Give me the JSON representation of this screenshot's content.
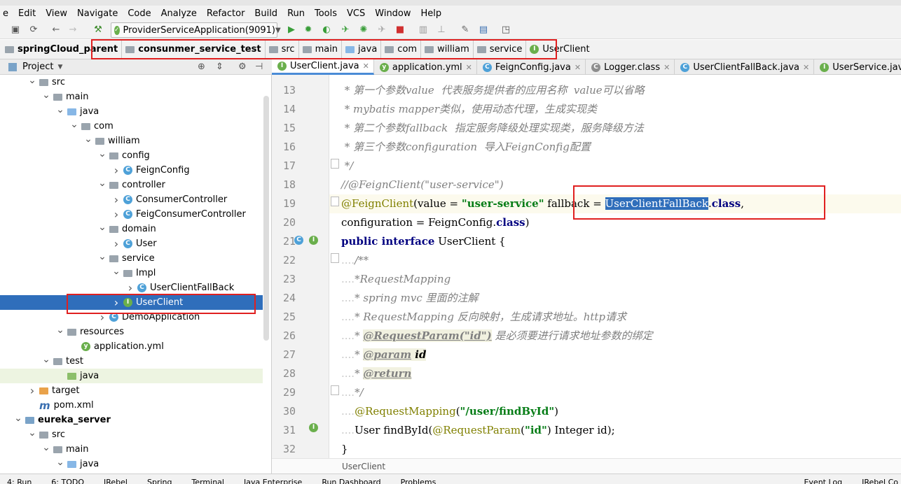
{
  "menu": [
    "e",
    "Edit",
    "View",
    "Navigate",
    "Code",
    "Analyze",
    "Refactor",
    "Build",
    "Run",
    "Tools",
    "VCS",
    "Window",
    "Help"
  ],
  "toolbar": {
    "run_config": "ProviderServiceApplication(9091)"
  },
  "breadcrumb": [
    "springCloud_parent",
    "consunmer_service_test",
    "src",
    "main",
    "java",
    "com",
    "william",
    "service",
    "UserClient"
  ],
  "project_panel": {
    "title": "Project"
  },
  "tree": [
    {
      "label": "src",
      "indent": 2,
      "arrow": "down",
      "icon": "folder"
    },
    {
      "label": "main",
      "indent": 3,
      "arrow": "down",
      "icon": "folder"
    },
    {
      "label": "java",
      "indent": 4,
      "arrow": "down",
      "icon": "folder-blue"
    },
    {
      "label": "com",
      "indent": 5,
      "arrow": "down",
      "icon": "package"
    },
    {
      "label": "william",
      "indent": 6,
      "arrow": "down",
      "icon": "package"
    },
    {
      "label": "config",
      "indent": 7,
      "arrow": "down",
      "icon": "package"
    },
    {
      "label": "FeignConfig",
      "indent": 8,
      "arrow": "right",
      "icon": "class"
    },
    {
      "label": "controller",
      "indent": 7,
      "arrow": "down",
      "icon": "package"
    },
    {
      "label": "ConsumerController",
      "indent": 8,
      "arrow": "right",
      "icon": "class"
    },
    {
      "label": "FeigConsumerController",
      "indent": 8,
      "arrow": "right",
      "icon": "class"
    },
    {
      "label": "domain",
      "indent": 7,
      "arrow": "down",
      "icon": "package"
    },
    {
      "label": "User",
      "indent": 8,
      "arrow": "right",
      "icon": "class"
    },
    {
      "label": "service",
      "indent": 7,
      "arrow": "down",
      "icon": "package"
    },
    {
      "label": "Impl",
      "indent": 8,
      "arrow": "down",
      "icon": "package"
    },
    {
      "label": "UserClientFallBack",
      "indent": 9,
      "arrow": "right",
      "icon": "class"
    },
    {
      "label": "UserClient",
      "indent": 8,
      "arrow": "right",
      "icon": "interface",
      "selected": true
    },
    {
      "label": "DemoApplication",
      "indent": 7,
      "arrow": "right",
      "icon": "spring"
    },
    {
      "label": "resources",
      "indent": 4,
      "arrow": "down",
      "icon": "folder-res"
    },
    {
      "label": "application.yml",
      "indent": 5,
      "arrow": "none",
      "icon": "yml"
    },
    {
      "label": "test",
      "indent": 3,
      "arrow": "down",
      "icon": "folder"
    },
    {
      "label": "java",
      "indent": 4,
      "arrow": "none",
      "icon": "folder-green",
      "highlight": true
    },
    {
      "label": "target",
      "indent": 2,
      "arrow": "right",
      "icon": "folder-orange"
    },
    {
      "label": "pom.xml",
      "indent": 2,
      "arrow": "none",
      "icon": "maven"
    },
    {
      "label": "eureka_server",
      "indent": 1,
      "arrow": "down",
      "icon": "module"
    },
    {
      "label": "src",
      "indent": 2,
      "arrow": "down",
      "icon": "folder"
    },
    {
      "label": "main",
      "indent": 3,
      "arrow": "down",
      "icon": "folder"
    },
    {
      "label": "java",
      "indent": 4,
      "arrow": "down",
      "icon": "folder-blue"
    }
  ],
  "tabs": [
    {
      "label": "UserClient.java",
      "icon": "interface",
      "active": true
    },
    {
      "label": "application.yml",
      "icon": "yml"
    },
    {
      "label": "FeignConfig.java",
      "icon": "class"
    },
    {
      "label": "Logger.class",
      "icon": "class-lib"
    },
    {
      "label": "UserClientFallBack.java",
      "icon": "class"
    },
    {
      "label": "UserService.java",
      "icon": "interface"
    }
  ],
  "code_lines": [
    {
      "n": "13",
      "t": " * 第一个参数value  代表服务提供者的应用名称  value可以省略"
    },
    {
      "n": "14",
      "t": " * mybatis mapper类似，使用动态代理，生成实现类"
    },
    {
      "n": "15",
      "t": " * 第二个参数fallback  指定服务降级处理实现类，服务降级方法"
    },
    {
      "n": "16",
      "t": " * 第三个参数configuration  导入FeignConfig配置"
    },
    {
      "n": "17",
      "t": " */"
    },
    {
      "n": "18",
      "t": "//@FeignClient(\"user-service\")"
    },
    {
      "n": "19",
      "t": "@FeignClient(value = \"user-service\" fallback = UserClientFallBack.class,"
    },
    {
      "n": "20",
      "t": "configuration = FeignConfig.class)"
    },
    {
      "n": "21",
      "t": "public interface UserClient {"
    },
    {
      "n": "22",
      "t": "    /**"
    },
    {
      "n": "23",
      "t": "    *RequestMapping"
    },
    {
      "n": "24",
      "t": "    * spring mvc 里面的注解"
    },
    {
      "n": "25",
      "t": "    * RequestMapping 反向映射，生成请求地址。http请求"
    },
    {
      "n": "26",
      "t": "    * @RequestParam(\"id\") 是必须要进行请求地址参数的绑定"
    },
    {
      "n": "27",
      "t": "    * @param id"
    },
    {
      "n": "28",
      "t": "    * @return"
    },
    {
      "n": "29",
      "t": "    */"
    },
    {
      "n": "30",
      "t": "    @RequestMapping(\"/user/findById\")"
    },
    {
      "n": "31",
      "t": "    User findById(@RequestParam(\"id\") Integer id);"
    },
    {
      "n": "32",
      "t": "}"
    }
  ],
  "code_parts": {
    "l13": " * 第一个参数value  代表服务提供者的应用名称  value可以省略",
    "l14": " * mybatis mapper类似，使用动态代理，生成实现类",
    "l15": " * 第二个参数fallback  指定服务降级处理实现类，服务降级方法",
    "l16": " * 第三个参数configuration  导入FeignConfig配置",
    "l17": " */",
    "l18": "//@FeignClient(\"user-service\")",
    "l19a": "@FeignClient",
    "l19b": "(value = ",
    "l19c": "\"user-service\"",
    "l19d": " fallback = ",
    "l19e": "UserClientFallBack",
    "l19f": ".",
    "l19g": "class",
    "l19h": ",",
    "l20a": "configuration = FeignConfig.",
    "l20b": "class",
    "l20c": ")",
    "l21a": "public interface",
    "l21b": " UserClient {",
    "l22": "/**",
    "l23": "*RequestMapping",
    "l24": "* spring mvc 里面的注解",
    "l25": "* RequestMapping 反向映射，生成请求地址。http请求",
    "l26a": "* ",
    "l26b": "@RequestParam(\"id\")",
    "l26c": " 是必须要进行请求地址参数的绑定",
    "l27a": "* ",
    "l27b": "@param",
    "l27c": " id",
    "l28a": "* ",
    "l28b": "@return",
    "l29": "*/",
    "l30a": "@RequestMapping",
    "l30b": "(",
    "l30c": "\"/user/findById\"",
    "l30d": ")",
    "l31a": "User findById(",
    "l31b": "@RequestParam",
    "l31c": "(",
    "l31d": "\"id\"",
    "l31e": ") Integer id);",
    "l32": "}"
  },
  "editor_footer": "UserClient",
  "statusbar": [
    "4: Run",
    "6: TODO",
    "JRebel",
    "Spring",
    "Terminal",
    "Java Enterprise",
    "Run Dashboard",
    "Problems",
    "Event Log",
    "JRebel Co"
  ]
}
